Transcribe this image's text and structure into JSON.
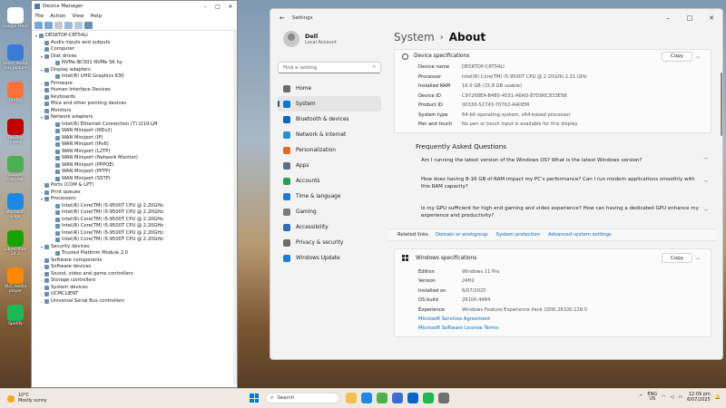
{
  "desktop": {
    "icons": [
      {
        "label": "Google Maps",
        "color": "#ffffff"
      },
      {
        "label": "Learn about this picture",
        "color": "#3a7bd5"
      },
      {
        "label": "Firefox",
        "color": "#ff7139"
      },
      {
        "label": "FileZilla Client",
        "color": "#bf0000"
      },
      {
        "label": "Google Chrome",
        "color": "#4caf50"
      },
      {
        "label": "Microsoft Edge",
        "color": "#1e88e5"
      },
      {
        "label": "LibreOffice 24.2",
        "color": "#18a303"
      },
      {
        "label": "VLC media player",
        "color": "#ff8800"
      },
      {
        "label": "Spotify",
        "color": "#1db954"
      }
    ]
  },
  "device_manager": {
    "title": "Device Manager",
    "menu": [
      "File",
      "Action",
      "View",
      "Help"
    ],
    "tree": [
      {
        "label": "DESKTOP-CRT54LI",
        "level": 0,
        "exp": "▾"
      },
      {
        "label": "Audio inputs and outputs",
        "level": 1,
        "exp": "›"
      },
      {
        "label": "Computer",
        "level": 1,
        "exp": "›"
      },
      {
        "label": "Disk drives",
        "level": 1,
        "exp": "▾"
      },
      {
        "label": "NVMe BC501 NVMe SK hy",
        "level": 2,
        "exp": ""
      },
      {
        "label": "Display adapters",
        "level": 1,
        "exp": "▾"
      },
      {
        "label": "Intel(R) UHD Graphics 630",
        "level": 2,
        "exp": ""
      },
      {
        "label": "Firmware",
        "level": 1,
        "exp": "›"
      },
      {
        "label": "Human Interface Devices",
        "level": 1,
        "exp": "›"
      },
      {
        "label": "Keyboards",
        "level": 1,
        "exp": "›"
      },
      {
        "label": "Mice and other pointing devices",
        "level": 1,
        "exp": "›"
      },
      {
        "label": "Monitors",
        "level": 1,
        "exp": "›"
      },
      {
        "label": "Network adapters",
        "level": 1,
        "exp": "▾"
      },
      {
        "label": "Intel(R) Ethernet Connection (7) I219-LM",
        "level": 2,
        "exp": ""
      },
      {
        "label": "WAN Miniport (IKEv2)",
        "level": 2,
        "exp": ""
      },
      {
        "label": "WAN Miniport (IP)",
        "level": 2,
        "exp": ""
      },
      {
        "label": "WAN Miniport (IPv6)",
        "level": 2,
        "exp": ""
      },
      {
        "label": "WAN Miniport (L2TP)",
        "level": 2,
        "exp": ""
      },
      {
        "label": "WAN Miniport (Network Monitor)",
        "level": 2,
        "exp": ""
      },
      {
        "label": "WAN Miniport (PPPOE)",
        "level": 2,
        "exp": ""
      },
      {
        "label": "WAN Miniport (PPTP)",
        "level": 2,
        "exp": ""
      },
      {
        "label": "WAN Miniport (SSTP)",
        "level": 2,
        "exp": ""
      },
      {
        "label": "Ports (COM & LPT)",
        "level": 1,
        "exp": "›"
      },
      {
        "label": "Print queues",
        "level": 1,
        "exp": "›"
      },
      {
        "label": "Processors",
        "level": 1,
        "exp": "▾"
      },
      {
        "label": "Intel(R) Core(TM) i5-9500T CPU @ 2.20GHz",
        "level": 2,
        "exp": ""
      },
      {
        "label": "Intel(R) Core(TM) i5-9500T CPU @ 2.20GHz",
        "level": 2,
        "exp": ""
      },
      {
        "label": "Intel(R) Core(TM) i5-9500T CPU @ 2.20GHz",
        "level": 2,
        "exp": ""
      },
      {
        "label": "Intel(R) Core(TM) i5-9500T CPU @ 2.20GHz",
        "level": 2,
        "exp": ""
      },
      {
        "label": "Intel(R) Core(TM) i5-9500T CPU @ 2.20GHz",
        "level": 2,
        "exp": ""
      },
      {
        "label": "Intel(R) Core(TM) i5-9500T CPU @ 2.20GHz",
        "level": 2,
        "exp": ""
      },
      {
        "label": "Security devices",
        "level": 1,
        "exp": "▾"
      },
      {
        "label": "Trusted Platform Module 2.0",
        "level": 2,
        "exp": ""
      },
      {
        "label": "Software components",
        "level": 1,
        "exp": "›"
      },
      {
        "label": "Software devices",
        "level": 1,
        "exp": "›"
      },
      {
        "label": "Sound, video and game controllers",
        "level": 1,
        "exp": "›"
      },
      {
        "label": "Storage controllers",
        "level": 1,
        "exp": "›"
      },
      {
        "label": "System devices",
        "level": 1,
        "exp": "›"
      },
      {
        "label": "UCMCLIENT",
        "level": 1,
        "exp": "›"
      },
      {
        "label": "Universal Serial Bus controllers",
        "level": 1,
        "exp": "›"
      }
    ]
  },
  "settings": {
    "title": "Settings",
    "user": {
      "name": "Dell",
      "type": "Local Account"
    },
    "search_placeholder": "Find a setting",
    "nav": [
      {
        "label": "Home",
        "color": "#6b6b6b",
        "selected": false
      },
      {
        "label": "System",
        "color": "#0078d4",
        "selected": true
      },
      {
        "label": "Bluetooth & devices",
        "color": "#0a66c2",
        "selected": false
      },
      {
        "label": "Network & internet",
        "color": "#2b8fd8",
        "selected": false
      },
      {
        "label": "Personalization",
        "color": "#e06c2b",
        "selected": false
      },
      {
        "label": "Apps",
        "color": "#5c6b8a",
        "selected": false
      },
      {
        "label": "Accounts",
        "color": "#2e9e57",
        "selected": false
      },
      {
        "label": "Time & language",
        "color": "#1f7ad1",
        "selected": false
      },
      {
        "label": "Gaming",
        "color": "#7a7a7a",
        "selected": false
      },
      {
        "label": "Accessibility",
        "color": "#2c6fbb",
        "selected": false
      },
      {
        "label": "Privacy & security",
        "color": "#6b6b6b",
        "selected": false
      },
      {
        "label": "Windows Update",
        "color": "#1a7fd4",
        "selected": false
      }
    ],
    "breadcrumb": {
      "parent": "System",
      "sep": "›",
      "current": "About"
    },
    "device_specs": {
      "title": "Device specifications",
      "copy": "Copy",
      "rows": [
        {
          "k": "Device name",
          "v": "DESKTOP-CRT54LI"
        },
        {
          "k": "Processor",
          "v": "Intel(R) Core(TM) i5-9500T CPU @ 2.20GHz   2.21 GHz"
        },
        {
          "k": "Installed RAM",
          "v": "16.0 GB (15.8 GB usable)"
        },
        {
          "k": "Device ID",
          "v": "C97268EA-B485-4551-A6AD-87D90C833E98"
        },
        {
          "k": "Product ID",
          "v": "00330-52743-70763-AAOEM"
        },
        {
          "k": "System type",
          "v": "64-bit operating system, x64-based processor"
        },
        {
          "k": "Pen and touch",
          "v": "No pen or touch input is available for this display"
        }
      ]
    },
    "faq": {
      "title": "Frequently Asked Questions",
      "items": [
        "Am I running the latest version of the Windows OS? What is the latest Windows version?",
        "How does having 8-16 GB of RAM impact my PC's performance? Can I run modern applications smoothly with this RAM capacity?",
        "Is my GPU sufficient for high end gaming and video experience? How can having a dedicated GPU enhance my experience and productivity?"
      ]
    },
    "related": {
      "label": "Related links",
      "links": [
        "Domain or workgroup",
        "System protection",
        "Advanced system settings"
      ]
    },
    "win_specs": {
      "title": "Windows specifications",
      "copy": "Copy",
      "rows": [
        {
          "k": "Edition",
          "v": "Windows 11 Pro"
        },
        {
          "k": "Version",
          "v": "24H2"
        },
        {
          "k": "Installed on",
          "v": "6/07/2025"
        },
        {
          "k": "OS build",
          "v": "26100.4484"
        },
        {
          "k": "Experience",
          "v": "Windows Feature Experience Pack 1000.26100.128.0"
        }
      ],
      "links": [
        "Microsoft Services Agreement",
        "Microsoft Software License Terms"
      ]
    }
  },
  "taskbar": {
    "weather": {
      "temp": "10°C",
      "desc": "Mostly sunny"
    },
    "search_placeholder": "Search",
    "apps": [
      {
        "name": "file-explorer",
        "color": "#f2c14e"
      },
      {
        "name": "edge",
        "color": "#1e88e5"
      },
      {
        "name": "chrome",
        "color": "#4caf50"
      },
      {
        "name": "store",
        "color": "#3c6fd1"
      },
      {
        "name": "outlook",
        "color": "#0a64c8"
      },
      {
        "name": "spotify",
        "color": "#1db954"
      },
      {
        "name": "settings",
        "color": "#707070"
      }
    ],
    "lang": [
      "ENG",
      "US"
    ],
    "time": "12:09 pm",
    "date": "6/07/2025"
  }
}
